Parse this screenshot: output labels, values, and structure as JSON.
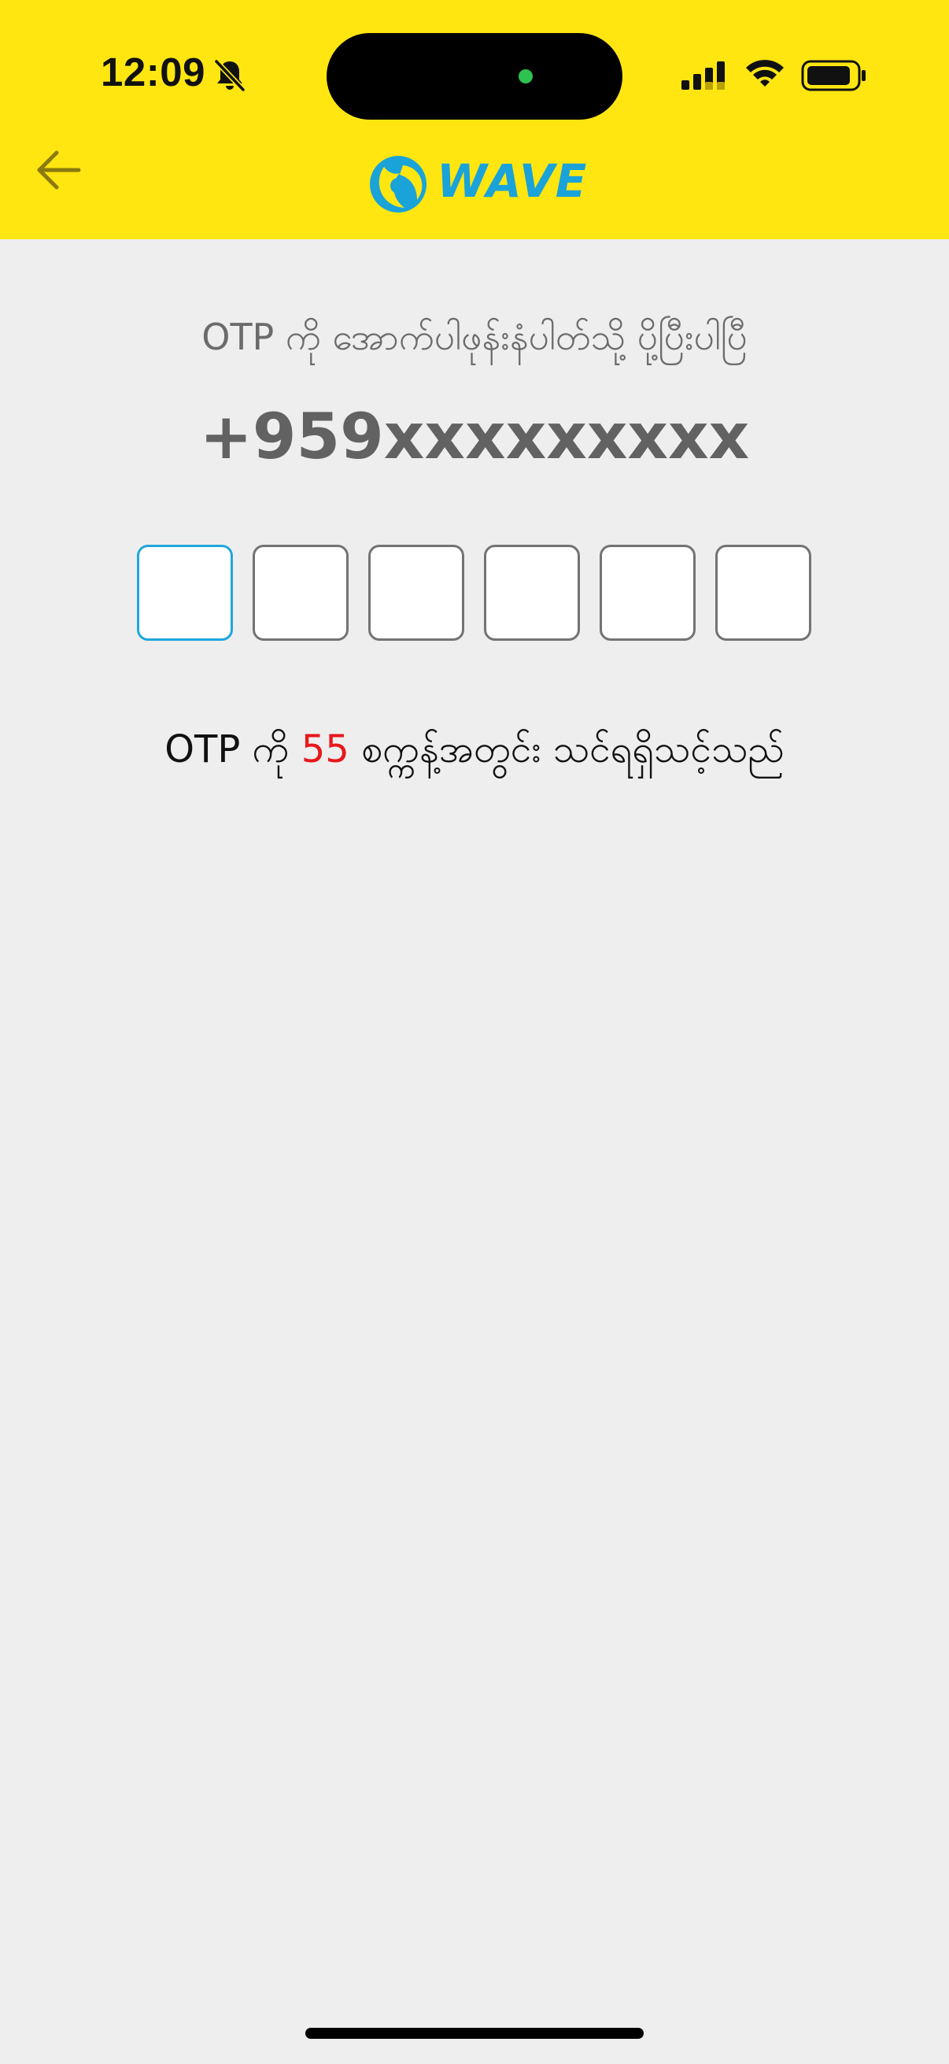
{
  "status_bar": {
    "time": "12:09",
    "icons": [
      "bell-off-icon",
      "signal-icon",
      "wifi-icon",
      "battery-icon"
    ]
  },
  "header": {
    "back_icon": "arrow-left-icon",
    "logo_text": "WAVE"
  },
  "main": {
    "instruction": "OTP ကို အောက်ပါဖုန်းနံပါတ်သို့ ပို့ပြီးပါပြီ",
    "phone_number": "+959xxxxxxxxx",
    "otp_length": 6,
    "timer_prefix": "OTP ကို ",
    "timer_seconds": "55",
    "timer_suffix": " စက္ကန့်အတွင်း သင်ရရှိသင့်သည်"
  },
  "colors": {
    "header_bg": "#ffe611",
    "page_bg": "#eeeeee",
    "accent": "#1ea7dd",
    "timer": "#e8171c"
  }
}
